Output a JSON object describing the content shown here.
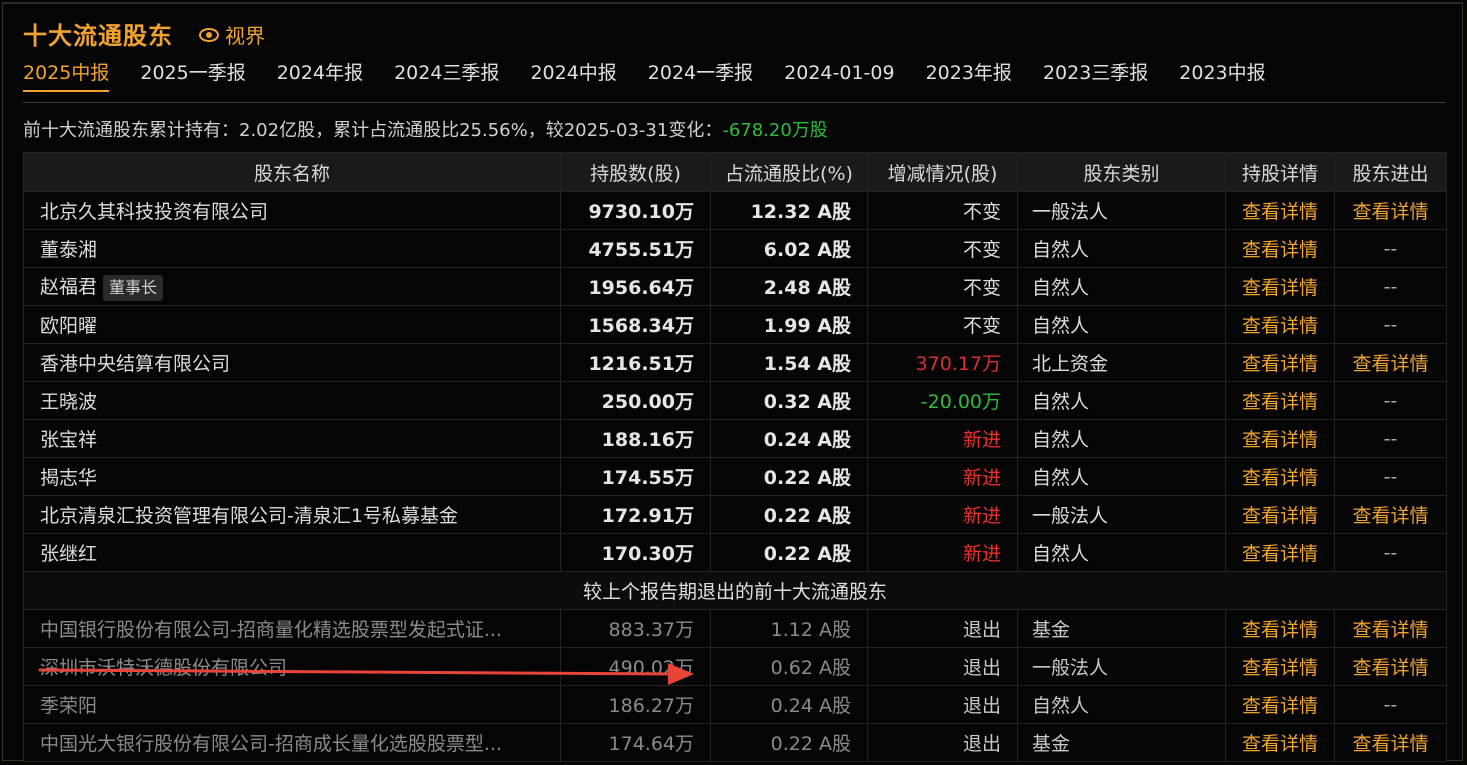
{
  "header": {
    "title": "十大流通股东",
    "vision_label": "视界"
  },
  "tabs": [
    "2025中报",
    "2025一季报",
    "2024年报",
    "2024三季报",
    "2024中报",
    "2024一季报",
    "2024-01-09",
    "2023年报",
    "2023三季报",
    "2023中报"
  ],
  "active_tab": 0,
  "summary": {
    "prefix": "前十大流通股东累计持有：2.02亿股，累计占流通股比25.56%，较2025-03-31变化：",
    "change": "-678.20万股"
  },
  "columns": [
    "股东名称",
    "持股数(股)",
    "占流通股比(%)",
    "增减情况(股)",
    "股东类别",
    "持股详情",
    "股东进出"
  ],
  "rows": [
    {
      "name": "北京久其科技投资有限公司",
      "badge": "",
      "shares": "9730.10万",
      "ratio": "12.32 A股",
      "change": "不变",
      "change_type": "same",
      "type": "一般法人",
      "detail": "查看详情",
      "inout": "查看详情"
    },
    {
      "name": "董泰湘",
      "badge": "",
      "shares": "4755.51万",
      "ratio": "6.02 A股",
      "change": "不变",
      "change_type": "same",
      "type": "自然人",
      "detail": "查看详情",
      "inout": "--"
    },
    {
      "name": "赵福君",
      "badge": "董事长",
      "shares": "1956.64万",
      "ratio": "2.48 A股",
      "change": "不变",
      "change_type": "same",
      "type": "自然人",
      "detail": "查看详情",
      "inout": "--"
    },
    {
      "name": "欧阳曜",
      "badge": "",
      "shares": "1568.34万",
      "ratio": "1.99 A股",
      "change": "不变",
      "change_type": "same",
      "type": "自然人",
      "detail": "查看详情",
      "inout": "--"
    },
    {
      "name": "香港中央结算有限公司",
      "badge": "",
      "shares": "1216.51万",
      "ratio": "1.54 A股",
      "change": "370.17万",
      "change_type": "pos",
      "type": "北上资金",
      "detail": "查看详情",
      "inout": "查看详情"
    },
    {
      "name": "王晓波",
      "badge": "",
      "shares": "250.00万",
      "ratio": "0.32 A股",
      "change": "-20.00万",
      "change_type": "neg",
      "type": "自然人",
      "detail": "查看详情",
      "inout": "--"
    },
    {
      "name": "张宝祥",
      "badge": "",
      "shares": "188.16万",
      "ratio": "0.24 A股",
      "change": "新进",
      "change_type": "new",
      "type": "自然人",
      "detail": "查看详情",
      "inout": "--"
    },
    {
      "name": "揭志华",
      "badge": "",
      "shares": "174.55万",
      "ratio": "0.22 A股",
      "change": "新进",
      "change_type": "new",
      "type": "自然人",
      "detail": "查看详情",
      "inout": "--"
    },
    {
      "name": "北京清泉汇投资管理有限公司-清泉汇1号私募基金",
      "badge": "",
      "shares": "172.91万",
      "ratio": "0.22 A股",
      "change": "新进",
      "change_type": "new",
      "type": "一般法人",
      "detail": "查看详情",
      "inout": "查看详情"
    },
    {
      "name": "张继红",
      "badge": "",
      "shares": "170.30万",
      "ratio": "0.22 A股",
      "change": "新进",
      "change_type": "new",
      "type": "自然人",
      "detail": "查看详情",
      "inout": "--"
    }
  ],
  "exited_section_label": "较上个报告期退出的前十大流通股东",
  "exited_rows": [
    {
      "name": "中国银行股份有限公司-招商量化精选股票型发起式证...",
      "shares": "883.37万",
      "ratio": "1.12 A股",
      "change": "退出",
      "type": "基金",
      "detail": "查看详情",
      "inout": "查看详情"
    },
    {
      "name": "深圳市沃特沃德股份有限公司",
      "shares": "490.02万",
      "ratio": "0.62 A股",
      "change": "退出",
      "type": "一般法人",
      "detail": "查看详情",
      "inout": "查看详情"
    },
    {
      "name": "季荣阳",
      "shares": "186.27万",
      "ratio": "0.24 A股",
      "change": "退出",
      "type": "自然人",
      "detail": "查看详情",
      "inout": "--"
    },
    {
      "name": "中国光大银行股份有限公司-招商成长量化选股股票型...",
      "shares": "174.64万",
      "ratio": "0.22 A股",
      "change": "退出",
      "type": "基金",
      "detail": "查看详情",
      "inout": "查看详情"
    }
  ],
  "colors": {
    "accent": "#f1a330",
    "up": "#d9302c",
    "down": "#2fbb3b",
    "annotation_arrow": "#e8443a"
  }
}
